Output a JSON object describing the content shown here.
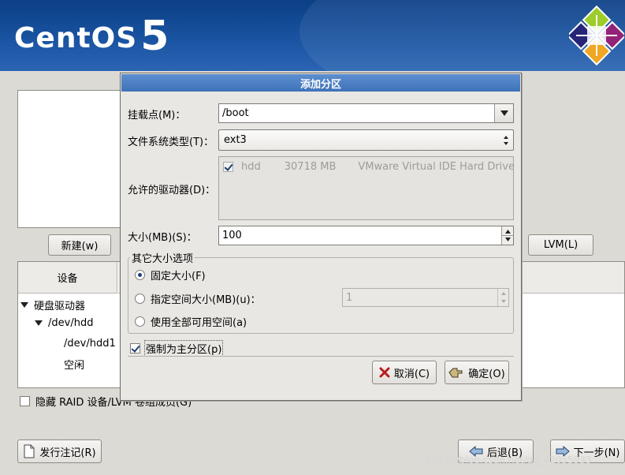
{
  "header": {
    "logo_text": "CentOS",
    "logo_number": "5"
  },
  "background": {
    "buttons": {
      "new": "新建(w)",
      "lvm": "LVM(L)",
      "release_notes": "发行注记(R)",
      "back": "后退(B)",
      "next": "下一步(N)"
    },
    "table": {
      "column_device": "设备",
      "tree": {
        "hard_drives": "硬盘驱动器",
        "disk": "/dev/hdd",
        "partition": "/dev/hdd1",
        "free": "空闲"
      }
    },
    "hide_raid_label": "隐藏 RAID 设备/LVM 卷组成员(G)",
    "watermark": "https://blog.csdn.net/qq_42055933"
  },
  "dialog": {
    "title": "添加分区",
    "mount_point": {
      "label": "挂载点(M)：",
      "value": "/boot"
    },
    "fs_type": {
      "label": "文件系统类型(T)：",
      "value": "ext3"
    },
    "allowed_drives": {
      "label": "允许的驱动器(D)：",
      "drive": {
        "name": "hdd",
        "size": "30718 MB",
        "model": "VMware Virtual IDE Hard Drive",
        "checked": true
      }
    },
    "size": {
      "label": "大小(MB)(S)：",
      "value": "100"
    },
    "other_size_options": {
      "legend": "其它大小选项",
      "fixed": {
        "label": "固定大小(F)",
        "selected": true
      },
      "fill_to": {
        "label": "指定空间大小(MB)(u)：",
        "value": "1",
        "selected": false
      },
      "fill_all": {
        "label": "使用全部可用空间(a)",
        "selected": false
      }
    },
    "force_primary": {
      "label": "强制为主分区(p)",
      "checked": true
    },
    "cancel_label": "取消(C)",
    "ok_label": "确定(O)"
  },
  "colors": {
    "header_blue": "#1b55a3",
    "dialog_title_blue": "#4a7fc4",
    "window_bg": "#dcdad5"
  }
}
